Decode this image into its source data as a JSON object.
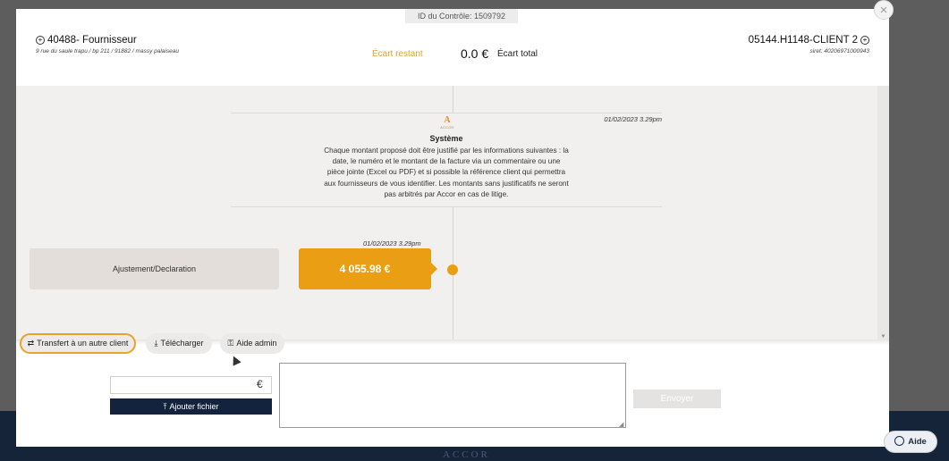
{
  "control": {
    "id_label": "ID du Contrôle: 1509792"
  },
  "supplier": {
    "name": "40488- Fournisseur",
    "address": "9 rue du saule trapu / bp 211 / 91882 / massy palaiseau"
  },
  "ecart": {
    "restant_label": "Écart restant",
    "amount": "0.0 €",
    "total_label": "Écart total"
  },
  "client": {
    "name": "05144.H1148-CLIENT 2",
    "siret": "siret: 40206971000943"
  },
  "system_message": {
    "logo": "A",
    "logo_sub": "ACCOR",
    "date": "01/02/2023 3.29pm",
    "title": "Système",
    "text": "Chaque montant proposé doit être justifié par les informations suivantes : la date, le numéro et le montant de la facture via un commentaire ou une pièce jointe (Excel ou PDF) et si possible la référence client qui permettra aux fournisseurs de vous identifier. Les montants sans justificatifs ne seront pas arbitrés par Accor en cas de litige."
  },
  "entry": {
    "label": "Ajustement/Declaration",
    "date": "01/02/2023 3.29pm",
    "amount": "4 055.98 €"
  },
  "toolbar": {
    "transfer": "Transfert à un autre client",
    "download": "Télécharger",
    "admin": "Aide admin"
  },
  "form": {
    "amount_value": "",
    "currency": "€",
    "add_file": "Ajouter fichier",
    "message_value": "",
    "send": "Envoyer"
  },
  "help": {
    "label": "Aide"
  },
  "background": {
    "brand": "ACCOR"
  },
  "colors": {
    "accent": "#ea9e14",
    "navy": "#13233e",
    "highlight": "#e9a22b"
  }
}
